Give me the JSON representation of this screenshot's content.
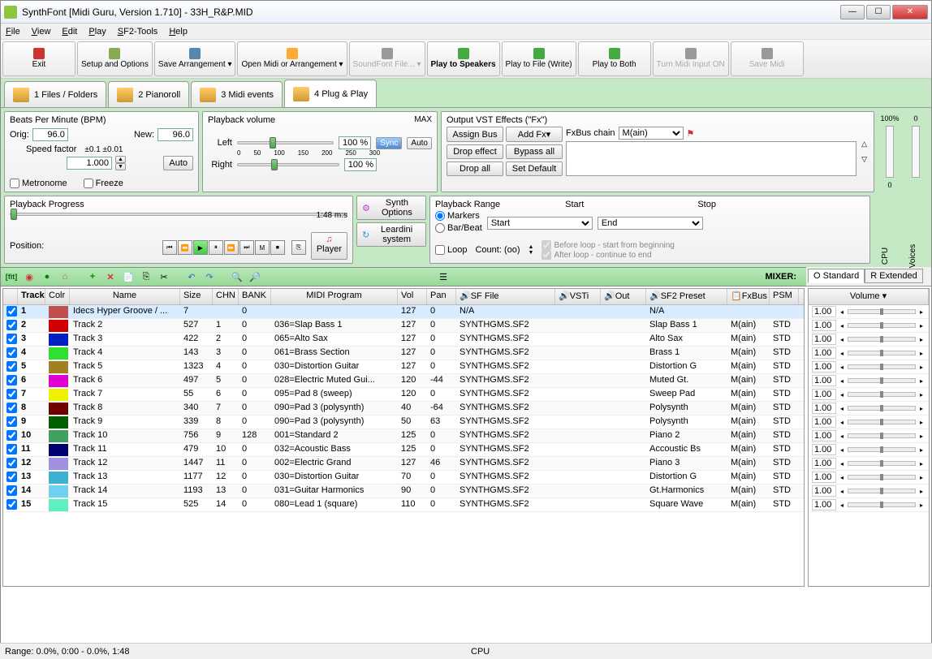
{
  "window": {
    "title": "SynthFont [Midi Guru, Version 1.710] - 33H_R&P.MID"
  },
  "menu": [
    "File",
    "View",
    "Edit",
    "Play",
    "SF2-Tools",
    "Help"
  ],
  "toolbar": [
    {
      "label": "Exit",
      "icon": "#c33"
    },
    {
      "label": "Setup and Options",
      "icon": "#8a5"
    },
    {
      "label": "Save Arrangement",
      "icon": "#58a",
      "dd": true
    },
    {
      "label": "Open Midi or Arrangement",
      "icon": "#fa3",
      "dd": true
    },
    {
      "label": "SoundFont File...",
      "icon": "#999",
      "dd": true,
      "disabled": true
    },
    {
      "label": "Play to Speakers",
      "icon": "#4a4",
      "bold": true
    },
    {
      "label": "Play to File (Write)",
      "icon": "#4a4"
    },
    {
      "label": "Play to Both",
      "icon": "#4a4"
    },
    {
      "label": "Turn Midi Input ON",
      "icon": "#999",
      "disabled": true
    },
    {
      "label": "Save Midi",
      "icon": "#999",
      "disabled": true
    }
  ],
  "tabs": [
    {
      "label": "1 Files / Folders"
    },
    {
      "label": "2 Pianoroll"
    },
    {
      "label": "3 Midi events"
    },
    {
      "label": "4 Plug & Play",
      "active": true
    }
  ],
  "bpm": {
    "title": "Beats Per Minute (BPM)",
    "orig_label": "Orig:",
    "orig": "96.0",
    "new_label": "New:",
    "new": "96.0",
    "speed_label": "Speed factor",
    "speed_tol": "±0.1  ±0.01",
    "speed": "1.000",
    "auto": "Auto",
    "metronome": "Metronome",
    "freeze": "Freeze"
  },
  "volume": {
    "title": "Playback volume",
    "max": "MAX",
    "left": "Left",
    "right": "Right",
    "pct1": "100 %",
    "pct2": "100 %",
    "sync": "Sync",
    "auto": "Auto",
    "ticks": [
      "0",
      "50",
      "100",
      "150",
      "200",
      "250",
      "300"
    ]
  },
  "fx": {
    "title": "Output VST Effects (\"Fx\")",
    "assign": "Assign Bus",
    "addfx": "Add Fx",
    "drop": "Drop effect",
    "bypass": "Bypass all",
    "dropall": "Drop all",
    "setdef": "Set Default",
    "chain_label": "FxBus chain",
    "chain": "M(ain)"
  },
  "progress": {
    "title": "Playback Progress",
    "pos": "Position:",
    "time": "1:48 m:s",
    "synth": "Synth Options",
    "player": "Player",
    "leardini": "Leardini system"
  },
  "range": {
    "title": "Playback Range",
    "markers": "Markers",
    "barbeat": "Bar/Beat",
    "start_h": "Start",
    "stop_h": "Stop",
    "start": "Start",
    "end": "End",
    "loop": "Loop",
    "count": "Count: (oo)",
    "before": "Before loop - start from beginning",
    "after": "After loop - continue to end"
  },
  "meters": {
    "cpu": "CPU",
    "voices": "Voices",
    "pct100": "100%",
    "zero": "0"
  },
  "mixer_label": "MIXER:",
  "ostabs": {
    "std": "O Standard",
    "ext": "R Extended",
    "vol": "Volume"
  },
  "headers": {
    "track": "Track",
    "color": "Colr",
    "name": "Name",
    "size": "Size",
    "chn": "CHN",
    "bank": "BANK",
    "prog": "MIDI Program",
    "vol": "Vol",
    "pan": "Pan",
    "sf": "SF File",
    "vsti": "VSTi",
    "out": "Out",
    "preset": "SF2 Preset",
    "fxbus": "FxBus",
    "psm": "PSM"
  },
  "tracks": [
    {
      "n": 1,
      "color": "#c05050",
      "name": "Idecs Hyper Groove / ...",
      "size": 7,
      "chn": "",
      "bank": 0,
      "prog": "",
      "vol": 127,
      "pan": 0,
      "sf": "N/A",
      "preset": "N/A",
      "fxbus": "",
      "psm": "",
      "sel": true
    },
    {
      "n": 2,
      "color": "#d00000",
      "name": "Track 2",
      "size": 527,
      "chn": 1,
      "bank": 0,
      "prog": "036=Slap Bass 1",
      "vol": 127,
      "pan": 0,
      "sf": "SYNTHGMS.SF2",
      "preset": "Slap Bass 1",
      "fxbus": "M(ain)",
      "psm": "STD"
    },
    {
      "n": 3,
      "color": "#0020c0",
      "name": "Track 3",
      "size": 422,
      "chn": 2,
      "bank": 0,
      "prog": "065=Alto Sax",
      "vol": 127,
      "pan": 0,
      "sf": "SYNTHGMS.SF2",
      "preset": "Alto Sax",
      "fxbus": "M(ain)",
      "psm": "STD"
    },
    {
      "n": 4,
      "color": "#30e030",
      "name": "Track 4",
      "size": 143,
      "chn": 3,
      "bank": 0,
      "prog": "061=Brass Section",
      "vol": 127,
      "pan": 0,
      "sf": "SYNTHGMS.SF2",
      "preset": "Brass 1",
      "fxbus": "M(ain)",
      "psm": "STD"
    },
    {
      "n": 5,
      "color": "#a08020",
      "name": "Track 5",
      "size": 1323,
      "chn": 4,
      "bank": 0,
      "prog": "030=Distortion Guitar",
      "vol": 127,
      "pan": 0,
      "sf": "SYNTHGMS.SF2",
      "preset": "Distortion G",
      "fxbus": "M(ain)",
      "psm": "STD"
    },
    {
      "n": 6,
      "color": "#e000d0",
      "name": "Track 6",
      "size": 497,
      "chn": 5,
      "bank": 0,
      "prog": "028=Electric Muted Gui...",
      "vol": 120,
      "pan": -44,
      "sf": "SYNTHGMS.SF2",
      "preset": "Muted Gt.",
      "fxbus": "M(ain)",
      "psm": "STD"
    },
    {
      "n": 7,
      "color": "#f0f000",
      "name": "Track 7",
      "size": 55,
      "chn": 6,
      "bank": 0,
      "prog": "095=Pad 8 (sweep)",
      "vol": 120,
      "pan": 0,
      "sf": "SYNTHGMS.SF2",
      "preset": "Sweep Pad",
      "fxbus": "M(ain)",
      "psm": "STD"
    },
    {
      "n": 8,
      "color": "#700000",
      "name": "Track 8",
      "size": 340,
      "chn": 7,
      "bank": 0,
      "prog": "090=Pad 3 (polysynth)",
      "vol": 40,
      "pan": -64,
      "sf": "SYNTHGMS.SF2",
      "preset": "Polysynth",
      "fxbus": "M(ain)",
      "psm": "STD"
    },
    {
      "n": 9,
      "color": "#006000",
      "name": "Track 9",
      "size": 339,
      "chn": 8,
      "bank": 0,
      "prog": "090=Pad 3 (polysynth)",
      "vol": 50,
      "pan": 63,
      "sf": "SYNTHGMS.SF2",
      "preset": "Polysynth",
      "fxbus": "M(ain)",
      "psm": "STD"
    },
    {
      "n": 10,
      "color": "#40a060",
      "name": "Track 10",
      "size": 756,
      "chn": 9,
      "bank": 128,
      "prog": "001=Standard 2",
      "vol": 125,
      "pan": 0,
      "sf": "SYNTHGMS.SF2",
      "preset": "Piano 2",
      "fxbus": "M(ain)",
      "psm": "STD"
    },
    {
      "n": 11,
      "color": "#000070",
      "name": "Track 11",
      "size": 479,
      "chn": 10,
      "bank": 0,
      "prog": "032=Acoustic Bass",
      "vol": 125,
      "pan": 0,
      "sf": "SYNTHGMS.SF2",
      "preset": "Accoustic Bs",
      "fxbus": "M(ain)",
      "psm": "STD"
    },
    {
      "n": 12,
      "color": "#a090e0",
      "name": "Track 12",
      "size": 1447,
      "chn": 11,
      "bank": 0,
      "prog": "002=Electric Grand",
      "vol": 127,
      "pan": 46,
      "sf": "SYNTHGMS.SF2",
      "preset": "Piano 3",
      "fxbus": "M(ain)",
      "psm": "STD"
    },
    {
      "n": 13,
      "color": "#40b0d0",
      "name": "Track 13",
      "size": 1177,
      "chn": 12,
      "bank": 0,
      "prog": "030=Distortion Guitar",
      "vol": 70,
      "pan": 0,
      "sf": "SYNTHGMS.SF2",
      "preset": "Distortion G",
      "fxbus": "M(ain)",
      "psm": "STD"
    },
    {
      "n": 14,
      "color": "#70d0f0",
      "name": "Track 14",
      "size": 1193,
      "chn": 13,
      "bank": 0,
      "prog": "031=Guitar Harmonics",
      "vol": 90,
      "pan": 0,
      "sf": "SYNTHGMS.SF2",
      "preset": "Gt.Harmonics",
      "fxbus": "M(ain)",
      "psm": "STD"
    },
    {
      "n": 15,
      "color": "#60f0c0",
      "name": "Track 15",
      "size": 525,
      "chn": 14,
      "bank": 0,
      "prog": "080=Lead 1 (square)",
      "vol": 110,
      "pan": 0,
      "sf": "SYNTHGMS.SF2",
      "preset": "Square Wave",
      "fxbus": "M(ain)",
      "psm": "STD"
    }
  ],
  "mixvals": [
    "1.00",
    "1.00",
    "1.00",
    "1.00",
    "1.00",
    "1.00",
    "1.00",
    "1.00",
    "1.00",
    "1.00",
    "1.00",
    "1.00",
    "1.00",
    "1.00",
    "1.00"
  ],
  "status": {
    "range": "Range: 0.0%, 0:00 - 0.0%, 1:48",
    "cpu": "CPU"
  }
}
